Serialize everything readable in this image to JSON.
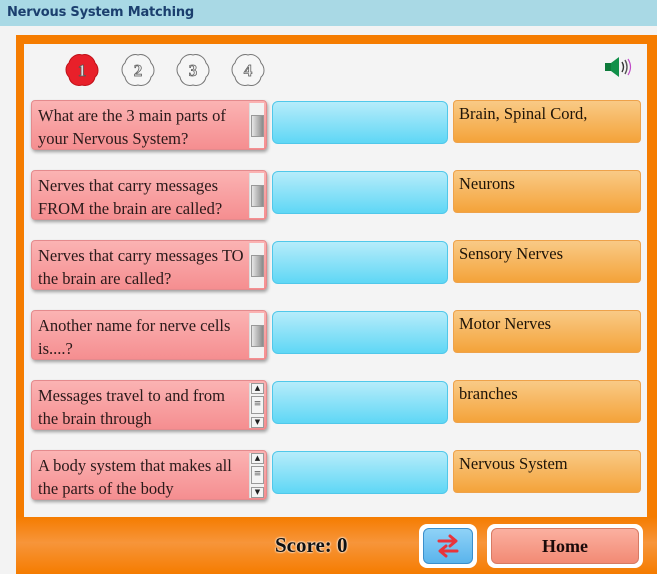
{
  "app": {
    "title": "Nervous System Matching"
  },
  "levels": [
    {
      "label": "1",
      "active": true
    },
    {
      "label": "2",
      "active": false
    },
    {
      "label": "3",
      "active": false
    },
    {
      "label": "4",
      "active": false
    }
  ],
  "sound_icon": "speaker-icon",
  "rows": [
    {
      "question": "What are the 3 main parts of your Nervous System?",
      "scroll": "thumb",
      "answer_slot": "",
      "answer": "Brain, Spinal Cord,"
    },
    {
      "question": "Nerves that carry messages FROM the brain are called?",
      "scroll": "thumb",
      "answer_slot": "",
      "answer": "Neurons"
    },
    {
      "question": "Nerves that carry messages TO the brain are called?",
      "scroll": "thumb",
      "answer_slot": "",
      "answer": "Sensory Nerves"
    },
    {
      "question": "Another name for nerve cells is....?",
      "scroll": "thumb",
      "answer_slot": "",
      "answer": "Motor Nerves"
    },
    {
      "question": "Messages travel to and from the brain through",
      "scroll": "arrows",
      "answer_slot": "",
      "answer": "branches"
    },
    {
      "question": "A body system that makes all the parts of the body",
      "scroll": "arrows",
      "answer_slot": "",
      "answer": "Nervous System"
    }
  ],
  "footer": {
    "score_label": "Score: 0",
    "swap_icon": "swap-arrows-icon",
    "home_label": "Home"
  },
  "colors": {
    "frame": "#f57c00",
    "titlebar": "#a9d9e5",
    "question": "#f58e90",
    "dropzone": "#5fd7f5",
    "answer": "#f4a33a",
    "active_level": "#e8202a"
  }
}
